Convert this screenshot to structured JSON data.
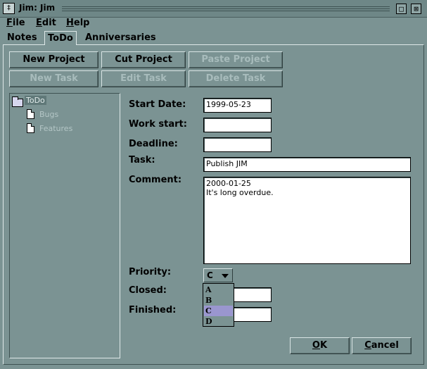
{
  "window": {
    "title": "Jim: Jim",
    "sys_icon": "app-menu-icon",
    "controls": [
      "maximize-icon",
      "close-icon"
    ]
  },
  "menubar": [
    {
      "label": "File",
      "mnemonic": "F",
      "rest": "ile"
    },
    {
      "label": "Edit",
      "mnemonic": "E",
      "rest": "dit"
    },
    {
      "label": "Help",
      "mnemonic": "H",
      "rest": "elp"
    }
  ],
  "tabs": [
    {
      "label": "Notes",
      "active": false
    },
    {
      "label": "ToDo",
      "active": true
    },
    {
      "label": "Anniversaries",
      "active": false
    }
  ],
  "toolbar": {
    "new_project": "New Project",
    "cut_project": "Cut Project",
    "paste_project": "Paste Project",
    "new_task": "New Task",
    "edit_task": "Edit Task",
    "delete_task": "Delete Task"
  },
  "tree": {
    "root": {
      "label": "ToDo",
      "icon": "folder-icon",
      "selected": true
    },
    "children": [
      {
        "label": "Bugs",
        "icon": "document-icon"
      },
      {
        "label": "Features",
        "icon": "document-icon"
      }
    ]
  },
  "form": {
    "start_date_label": "Start Date:",
    "start_date_value": "1999-05-23",
    "work_start_label": "Work start:",
    "work_start_value": "",
    "deadline_label": "Deadline:",
    "deadline_value": "",
    "task_label": "Task:",
    "task_value": "Publish JIM",
    "comment_label": "Comment:",
    "comment_value": "2000-01-25\nIt's long overdue.",
    "priority_label": "Priority:",
    "priority_value": "C",
    "priority_options": [
      "A",
      "B",
      "C",
      "D"
    ],
    "closed_label": "Closed:",
    "closed_value": "",
    "finished_label": "Finished:",
    "finished_value": ""
  },
  "dialog_buttons": {
    "ok": {
      "label": "OK",
      "mnemonic": "O",
      "rest": "K"
    },
    "cancel": {
      "label": "Cancel",
      "mnemonic": "C",
      "rest": "ancel"
    }
  },
  "colors": {
    "background": "#7b9393",
    "selection": "#9a96cf"
  }
}
